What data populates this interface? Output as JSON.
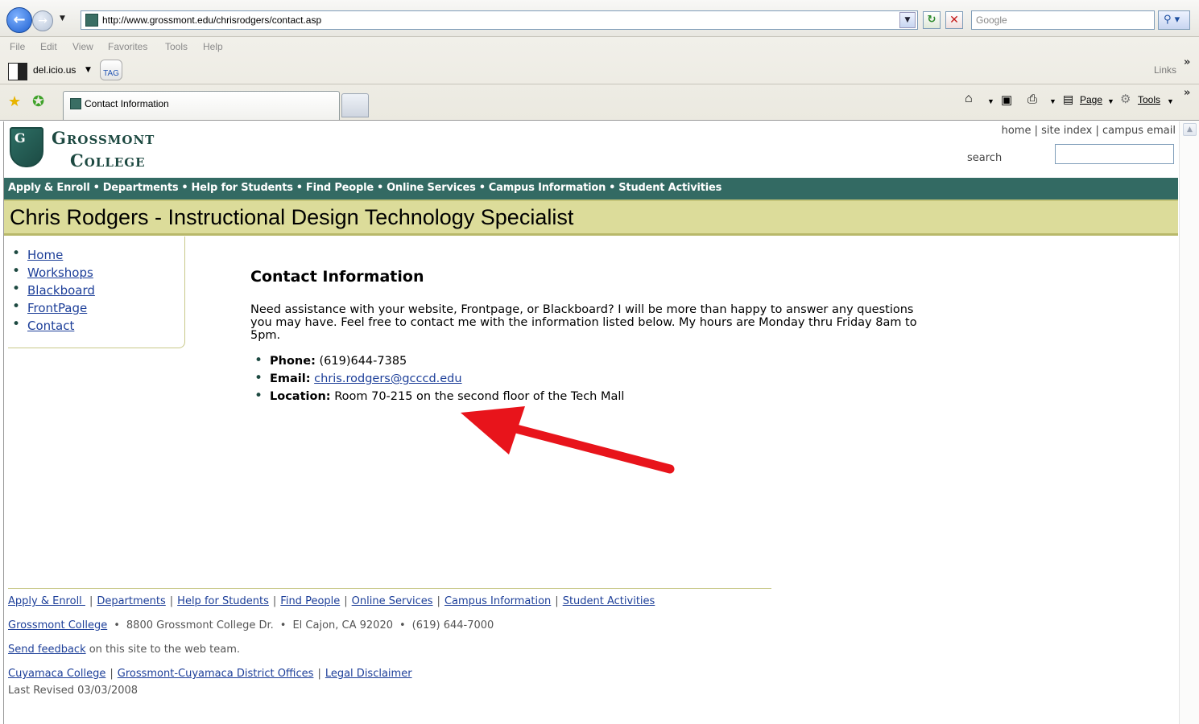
{
  "browser": {
    "url": "http://www.grossmont.edu/chrisrodgers/contact.asp",
    "search_placeholder": "Google",
    "menu": [
      "File",
      "Edit",
      "View",
      "Favorites",
      "Tools",
      "Help"
    ],
    "links_bar": {
      "delicious_label": "del.icio.us",
      "tag_label": "TAG",
      "links_label": "Links"
    },
    "tab": {
      "title": "Contact Information"
    },
    "command_bar": {
      "page_label": "Page",
      "tools_label": "Tools"
    }
  },
  "site": {
    "logo": {
      "shield_letters": "G",
      "word1": "Grossmont",
      "word2": "College"
    },
    "util_links": [
      "home",
      "site index",
      "campus email"
    ],
    "search_label": "search",
    "topnav": [
      "Apply & Enroll",
      "Departments",
      "Help for Students",
      "Find People",
      "Online Services",
      "Campus Information",
      "Student Activities"
    ],
    "banner_title": "Chris Rodgers - Instructional Design Technology Specialist",
    "sidebar": [
      "Home",
      "Workshops",
      "Blackboard",
      "FrontPage",
      "Contact"
    ],
    "content": {
      "heading": "Contact Information",
      "paragraph": "Need assistance with your website, Frontpage, or Blackboard? I will be more than happy to answer any questions you may have. Feel free to contact me with the information listed below. My hours are Monday thru Friday 8am to 5pm.",
      "phone_label": "Phone:",
      "phone_value": "(619)644-7385",
      "email_label": "Email:",
      "email_value": "chris.rodgers@gcccd.edu",
      "location_label": "Location:",
      "location_value": "Room 70-215 on the second floor of the Tech Mall"
    },
    "footer": {
      "nav": [
        "Apply & Enroll ",
        "Departments",
        "Help for Students",
        "Find People",
        "Online Services",
        "Campus Information",
        "Student Activities"
      ],
      "college_link": "Grossmont College",
      "address": "8800 Grossmont College Dr.",
      "city": "El Cajon, CA  92020",
      "phone": "(619) 644-7000",
      "feedback_link": "Send feedback",
      "feedback_text": " on this site to the web team.",
      "bottom_links": [
        "Cuyamaca College",
        "Grossmont-Cuyamaca District Offices",
        "Legal Disclaimer"
      ],
      "last_revised": "Last Revised 03/03/2008"
    }
  },
  "colors": {
    "nav_green": "#336a63",
    "banner_khaki": "#dcdc9a",
    "link_blue": "#1d3f99",
    "annotation_arrow": "#e8141b"
  }
}
